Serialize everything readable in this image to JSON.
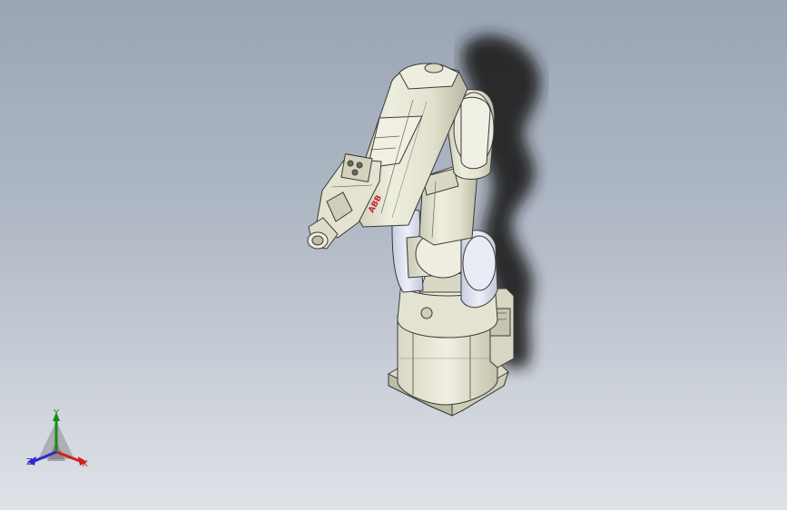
{
  "scene": {
    "background_top": "#9aa5b5",
    "background_bottom": "#dfe2e7",
    "model_color": "#e6e6d6",
    "model_shade": "#c9c8b4",
    "edge_color": "#3a3a3a",
    "brand_color": "#c0282d",
    "brand_text": "ABB"
  },
  "triad": {
    "x_label": "X",
    "y_label": "Y",
    "z_label": "Z",
    "x_color": "#d02020",
    "y_color": "#1a8a1a",
    "z_color": "#2a2ad0"
  }
}
